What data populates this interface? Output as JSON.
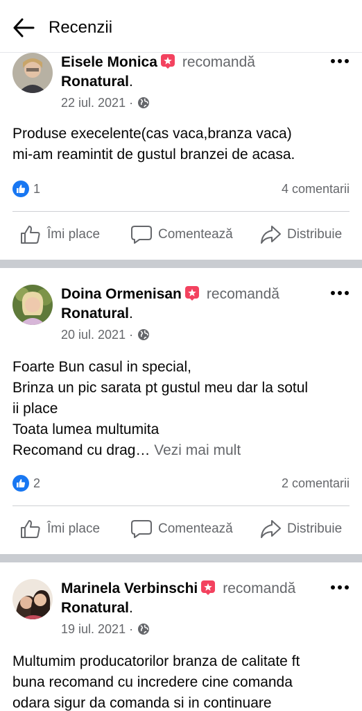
{
  "header": {
    "title": "Recenzii"
  },
  "posts": [
    {
      "author": "Eisele Monica",
      "verb": "recomandă",
      "page": "Ronatural",
      "page_suffix": ".",
      "date": "22 iul. 2021 ·",
      "text_lines": [
        "Produse execelente(cas vaca,branza vaca)",
        "mi-am reamintit de gustul branzei de acasa."
      ],
      "see_more": "",
      "likes": "1",
      "comments": "4 comentarii"
    },
    {
      "author": "Doina Ormenisan",
      "verb": "recomandă",
      "page": "Ronatural",
      "page_suffix": ".",
      "date": "20 iul. 2021 ·",
      "text_lines": [
        "Foarte Bun casul in special,",
        "Brinza un pic sarata pt gustul meu dar la sotul",
        "ii place",
        "Toata lumea multumita",
        "Recomand cu drag…"
      ],
      "see_more": "Vezi mai mult",
      "likes": "2",
      "comments": "2 comentarii"
    },
    {
      "author": "Marinela Verbinschi",
      "verb": "recomandă",
      "page": "Ronatural",
      "page_suffix": ".",
      "date": "19 iul. 2021 ·",
      "text_lines": [
        "Multumim producatorilor branza de calitate ft",
        "buna recomand cu incredere cine comanda",
        "odara sigur da comanda si in continuare"
      ],
      "see_more": ""
    }
  ],
  "actions": {
    "like": "Îmi place",
    "comment": "Comentează",
    "share": "Distribuie"
  },
  "colors": {
    "like_blue": "#1877f2",
    "recommend_red": "#f3425f",
    "divider": "#c9ccd1",
    "secondary_text": "#65676b"
  }
}
